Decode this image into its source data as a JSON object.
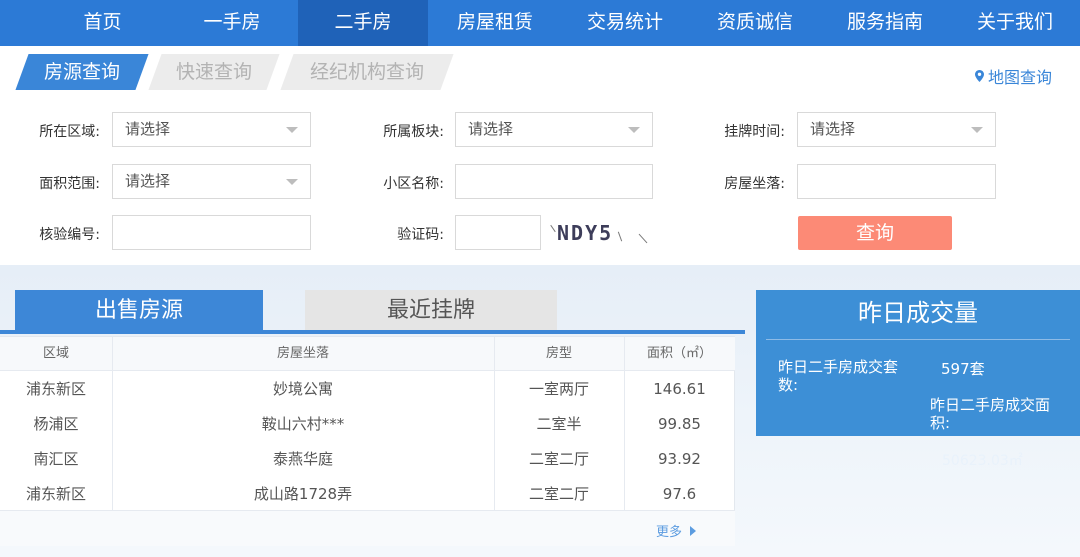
{
  "nav": {
    "items": [
      {
        "label": "首页"
      },
      {
        "label": "一手房"
      },
      {
        "label": "二手房",
        "active": true
      },
      {
        "label": "房屋租赁"
      },
      {
        "label": "交易统计"
      },
      {
        "label": "资质诚信"
      },
      {
        "label": "服务指南"
      },
      {
        "label": "关于我们"
      }
    ]
  },
  "search_tabs": [
    {
      "label": "房源查询",
      "active": true
    },
    {
      "label": "快速查询"
    },
    {
      "label": "经纪机构查询"
    }
  ],
  "map_link": "地图查询",
  "form": {
    "region": {
      "label": "所在区域:",
      "value": "请选择"
    },
    "block": {
      "label": "所属板块:",
      "value": "请选择"
    },
    "listing_time": {
      "label": "挂牌时间:",
      "value": "请选择"
    },
    "area_range": {
      "label": "面积范围:",
      "value": "请选择"
    },
    "community": {
      "label": "小区名称:",
      "value": ""
    },
    "address": {
      "label": "房屋坐落:",
      "value": ""
    },
    "verify_no": {
      "label": "核验编号:",
      "value": ""
    },
    "captcha": {
      "label": "验证码:",
      "value": "",
      "image_text": "NDY5"
    },
    "submit_label": "查询"
  },
  "listing_tabs": [
    {
      "label": "出售房源",
      "active": true
    },
    {
      "label": "最近挂牌"
    }
  ],
  "listing_table": {
    "headers": [
      "区域",
      "房屋坐落",
      "房型",
      "面积（㎡）"
    ],
    "rows": [
      [
        "浦东新区",
        "妙境公寓",
        "一室两厅",
        "146.61"
      ],
      [
        "杨浦区",
        "鞍山六村***",
        "二室半",
        "99.85"
      ],
      [
        "南汇区",
        "泰燕华庭",
        "二室二厅",
        "93.92"
      ],
      [
        "浦东新区",
        "成山路1728弄",
        "二室二厅",
        "97.6"
      ]
    ],
    "more": "更多"
  },
  "daily_volume": {
    "title": "昨日成交量",
    "count_label": "昨日二手房成交套数:",
    "count_value": "597套",
    "area_label": "昨日二手房成交面积:",
    "area_value": "50623.03㎡"
  },
  "colors": {
    "nav_bg": "#2c7ad6",
    "nav_active": "#1f62b8",
    "accent_blue": "#3d87d7",
    "query_button": "#fc8a76"
  }
}
